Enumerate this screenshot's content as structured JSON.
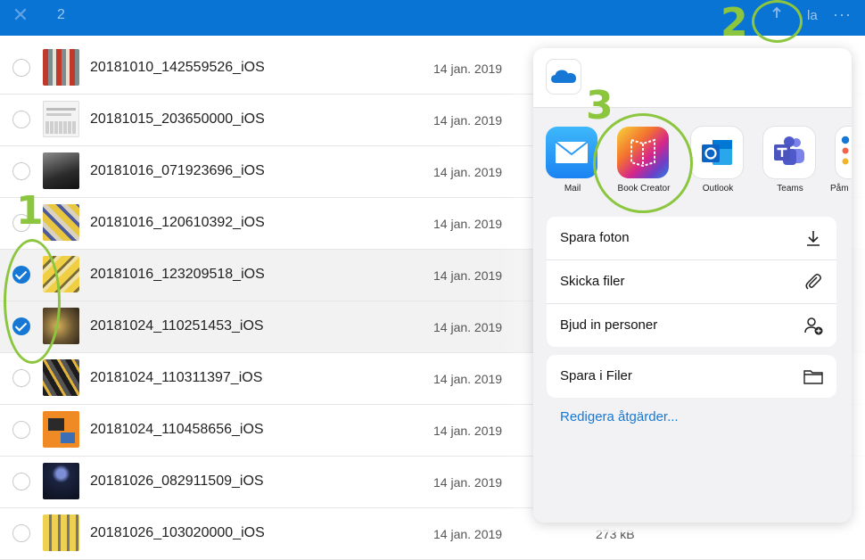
{
  "topbar": {
    "close_icon": "close-icon",
    "selected_count": "2",
    "share_icon": "share-icon",
    "right_label": "la",
    "more_label": "···"
  },
  "files": [
    {
      "name": "20181010_142559526_iOS",
      "date": "14 jan. 2019",
      "size": "",
      "selected": false,
      "thumb": "photo-red"
    },
    {
      "name": "20181015_203650000_iOS",
      "date": "14 jan. 2019",
      "size": "",
      "selected": false,
      "thumb": "photo-keyboard"
    },
    {
      "name": "20181016_071923696_iOS",
      "date": "14 jan. 2019",
      "size": "",
      "selected": false,
      "thumb": "photo-dark"
    },
    {
      "name": "20181016_120610392_iOS",
      "date": "14 jan. 2019",
      "size": "",
      "selected": false,
      "thumb": "photo-yellow"
    },
    {
      "name": "20181016_123209518_iOS",
      "date": "14 jan. 2019",
      "size": "",
      "selected": true,
      "thumb": "photo-yellow2"
    },
    {
      "name": "20181024_110251453_iOS",
      "date": "14 jan. 2019",
      "size": "",
      "selected": true,
      "thumb": "photo-brown"
    },
    {
      "name": "20181024_110311397_iOS",
      "date": "14 jan. 2019",
      "size": "",
      "selected": false,
      "thumb": "photo-black"
    },
    {
      "name": "20181024_110458656_iOS",
      "date": "14 jan. 2019",
      "size": "",
      "selected": false,
      "thumb": "photo-orange"
    },
    {
      "name": "20181026_082911509_iOS",
      "date": "14 jan. 2019",
      "size": "",
      "selected": false,
      "thumb": "photo-night"
    },
    {
      "name": "20181026_103020000_iOS",
      "date": "14 jan. 2019",
      "size": "273 kB",
      "selected": false,
      "thumb": "photo-yellow3"
    }
  ],
  "share_sheet": {
    "source_icon": "onedrive-icon",
    "apps": [
      {
        "label": "Mail",
        "icon": "mail-icon"
      },
      {
        "label": "Book Creator",
        "icon": "book-creator-icon"
      },
      {
        "label": "Outlook",
        "icon": "outlook-icon"
      },
      {
        "label": "Teams",
        "icon": "teams-icon"
      },
      {
        "label": "Påm",
        "icon": "reminders-icon"
      }
    ],
    "group1": [
      {
        "label": "Spara foton",
        "icon": "download-icon"
      },
      {
        "label": "Skicka filer",
        "icon": "paperclip-icon"
      },
      {
        "label": "Bjud in personer",
        "icon": "add-person-icon"
      }
    ],
    "group2": [
      {
        "label": "Spara i Filer",
        "icon": "folder-icon"
      }
    ],
    "edit_actions": "Redigera åtgärder..."
  },
  "annotations": {
    "step1": "1",
    "step2": "2",
    "step3": "3",
    "color": "#8cc63f"
  },
  "colors": {
    "topbar": "#0a74d4",
    "accent": "#1678d4"
  }
}
